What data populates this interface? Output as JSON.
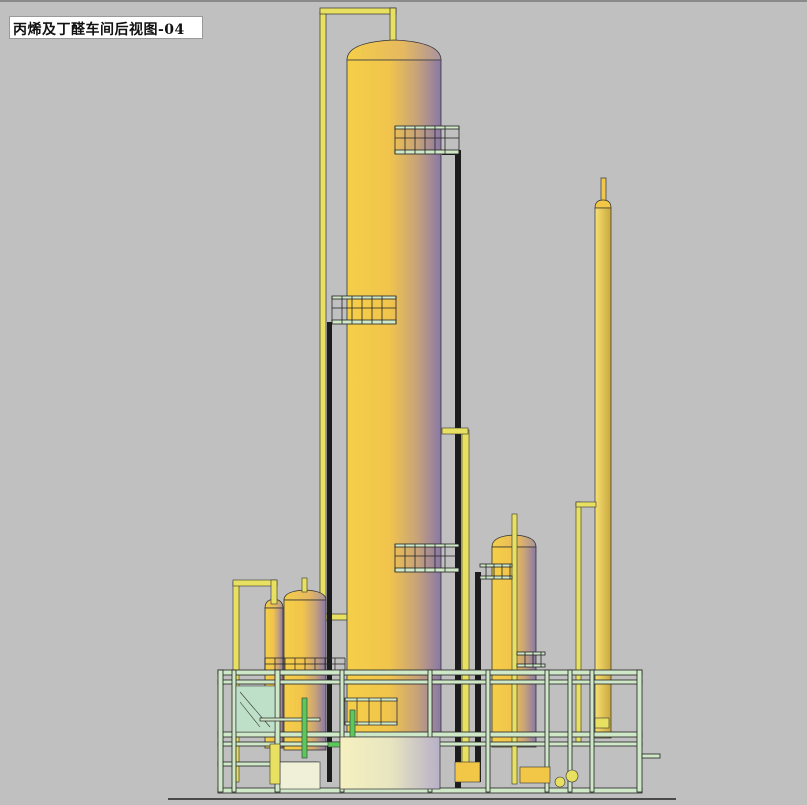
{
  "drawing": {
    "title": "丙烯及丁醛车间后视图-04",
    "background_color": "#c0c0c0",
    "vessel_color": "#f2c646",
    "vessel_shade_color": "#8878a8",
    "frame_color": "#cfe8c8",
    "pipe_color": "#e8e060",
    "dark_pipe_color": "#1c1c1c"
  }
}
